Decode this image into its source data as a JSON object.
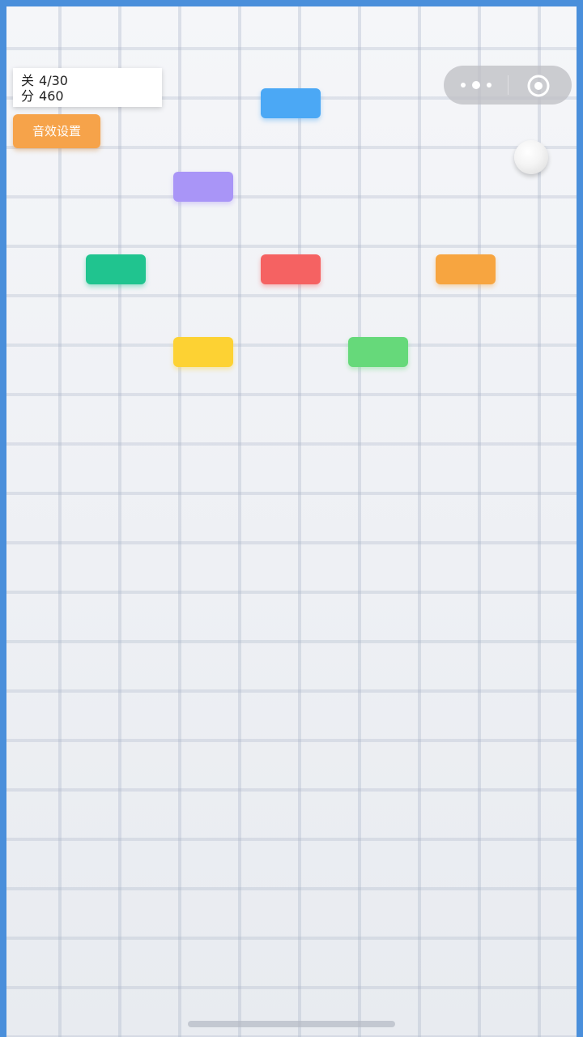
{
  "hud": {
    "level_label": "关",
    "level_value": "4/30",
    "score_label": "分",
    "score_value": "460"
  },
  "sound_button": {
    "label": "音效设置"
  },
  "capsule": {
    "more_icon": "more-dots-icon",
    "close_icon": "target-circle-icon"
  },
  "blocks": [
    {
      "color": "#4ba8f5"
    },
    {
      "color": "#a995f7"
    },
    {
      "color": "#20c48f"
    },
    {
      "color": "#f56262"
    },
    {
      "color": "#f7a540"
    },
    {
      "color": "#fdd233"
    },
    {
      "color": "#66d97a"
    }
  ],
  "colors": {
    "frame_border": "#4a8fdb",
    "background": "#eef0f4",
    "accent_button": "#f6a34a"
  }
}
